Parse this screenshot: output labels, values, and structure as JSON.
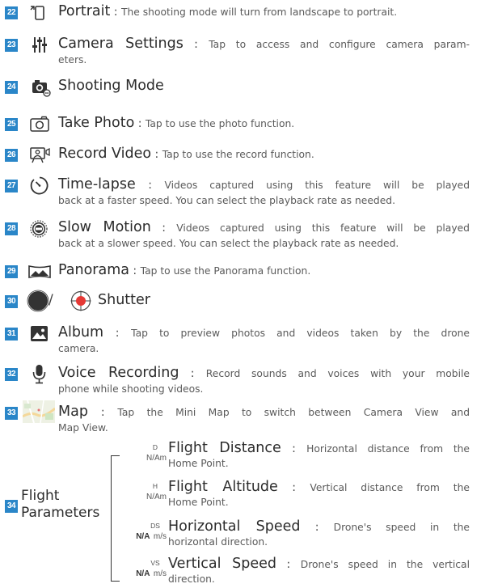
{
  "items": [
    {
      "num": "22",
      "icon": "portrait-icon",
      "title": "Portrait",
      "sep": " : ",
      "desc": "The shooting mode will turn from landscape to portrait."
    },
    {
      "num": "23",
      "icon": "camera-settings-icon",
      "title": "Camera Settings",
      "sep": " : ",
      "desc": "Tap to access and configure camera param-",
      "desc2": "eters."
    },
    {
      "num": "24",
      "icon": "shooting-mode-icon",
      "title": "Shooting Mode"
    },
    {
      "num": "25",
      "icon": "take-photo-icon",
      "title": "Take Photo",
      "sep": " : ",
      "desc": "Tap to use the photo function."
    },
    {
      "num": "26",
      "icon": "record-video-icon",
      "title": "Record Video",
      "sep": " : ",
      "desc": "Tap to use the record function."
    },
    {
      "num": "27",
      "icon": "time-lapse-icon",
      "title": "Time-lapse",
      "sep": " : ",
      "desc": "Videos captured using this feature will be played",
      "desc2": "back at a faster speed. You can select the playback rate as needed."
    },
    {
      "num": "28",
      "icon": "slow-motion-icon",
      "title": "Slow Motion",
      "sep": " : ",
      "desc": "Videos captured using this feature will be played",
      "desc2": "back at a slower speed. You can select the playback rate as needed."
    },
    {
      "num": "29",
      "icon": "panorama-icon",
      "title": "Panorama",
      "sep": " : ",
      "desc": "Tap to use the Panorama function."
    },
    {
      "num": "30",
      "icon": "shutter-icon",
      "title": "Shutter",
      "sep": " / "
    },
    {
      "num": "31",
      "icon": "album-icon",
      "title": "Album",
      "sep": " : ",
      "desc": "Tap to preview photos and videos taken by the drone",
      "desc2": "camera."
    },
    {
      "num": "32",
      "icon": "microphone-icon",
      "title": "Voice Recording",
      "sep": " : ",
      "desc": "Record sounds and voices with your mobile",
      "desc2": "phone while shooting videos."
    },
    {
      "num": "33",
      "icon": "mini-map-icon",
      "title": "Map",
      "sep": " : ",
      "desc": "Tap the Mini Map to switch between Camera View and",
      "desc2": "Map View."
    }
  ],
  "flight": {
    "num": "34",
    "label_line1": "Flight",
    "label_line2": "Parameters",
    "params": [
      {
        "lbl": "D",
        "val": "N/A",
        "unit": "m",
        "title": "Flight Distance",
        "sep": " : ",
        "desc": "Horizontal distance from the",
        "desc2": "Home Point."
      },
      {
        "lbl": "H",
        "val": "N/A",
        "unit": "m",
        "title": "Flight Altitude",
        "sep": " : ",
        "desc": "Vertical distance from the",
        "desc2": "Home Point."
      },
      {
        "lbl": "DS",
        "val": "N/A",
        "unit": "m/s",
        "title": "Horizontal Speed",
        "sep": " : ",
        "desc": "Drone's speed in the",
        "desc2": "horizontal direction."
      },
      {
        "lbl": "VS",
        "val": "N/A",
        "unit": "m/s",
        "title": "Vertical Speed",
        "sep": " : ",
        "desc": "Drone's speed in the vertical",
        "desc2": "direction."
      }
    ]
  },
  "colors": {
    "badge": "#2a86c8",
    "shutter_red": "#e53935"
  }
}
